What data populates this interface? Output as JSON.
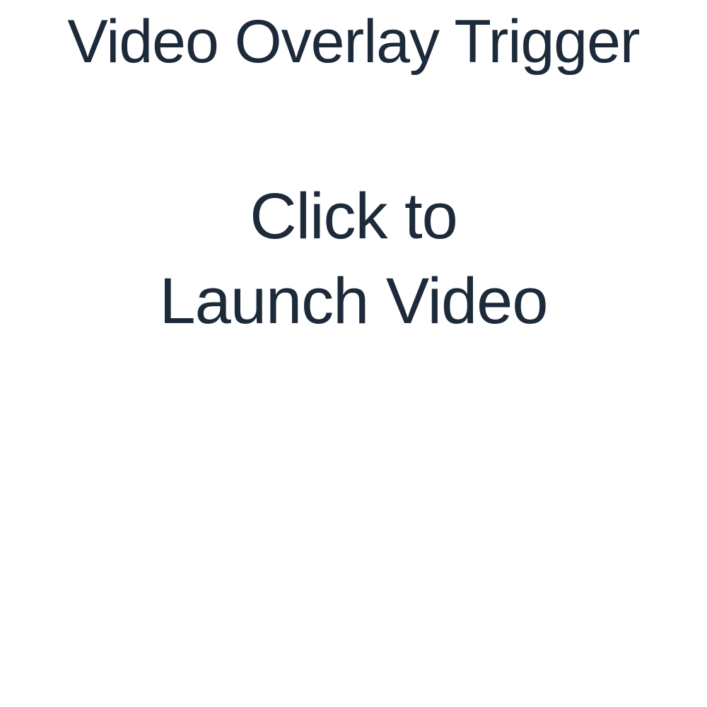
{
  "page": {
    "title": "Video Overlay Trigger",
    "text_color": "#1c2a3a",
    "background_color": "#ffffff"
  },
  "trigger": {
    "line1": "Click to",
    "line2": "Launch Video"
  }
}
